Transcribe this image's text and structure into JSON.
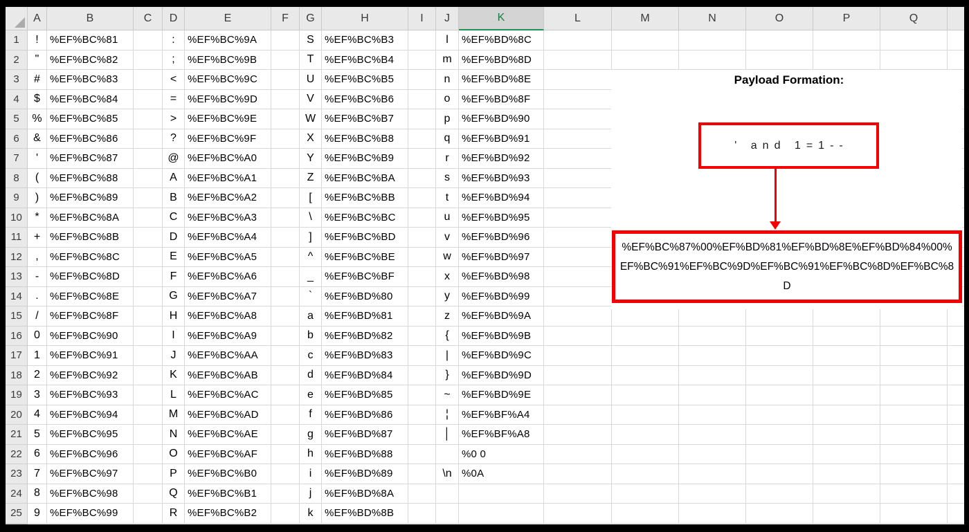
{
  "sheet": {
    "selected_column": "K",
    "columns": [
      "A",
      "B",
      "C",
      "D",
      "E",
      "F",
      "G",
      "H",
      "I",
      "J",
      "K",
      "L",
      "M",
      "N",
      "O",
      "P",
      "Q"
    ],
    "rows": [
      {
        "n": "1",
        "A": "!",
        "B": "%EF%BC%81",
        "D": ":",
        "E": "%EF%BC%9A",
        "G": "S",
        "H": "%EF%BC%B3",
        "J": "l",
        "K": "%EF%BD%8C"
      },
      {
        "n": "2",
        "A": "\"",
        "B": "%EF%BC%82",
        "D": ";",
        "E": "%EF%BC%9B",
        "G": "T",
        "H": "%EF%BC%B4",
        "J": "m",
        "K": "%EF%BD%8D"
      },
      {
        "n": "3",
        "A": "#",
        "B": "%EF%BC%83",
        "D": "<",
        "E": "%EF%BC%9C",
        "G": "U",
        "H": "%EF%BC%B5",
        "J": "n",
        "K": "%EF%BD%8E"
      },
      {
        "n": "4",
        "A": "$",
        "B": "%EF%BC%84",
        "D": "=",
        "E": "%EF%BC%9D",
        "G": "V",
        "H": "%EF%BC%B6",
        "J": "o",
        "K": "%EF%BD%8F"
      },
      {
        "n": "5",
        "A": "%",
        "B": "%EF%BC%85",
        "D": ">",
        "E": "%EF%BC%9E",
        "G": "W",
        "H": "%EF%BC%B7",
        "J": "p",
        "K": "%EF%BD%90"
      },
      {
        "n": "6",
        "A": "&",
        "B": "%EF%BC%86",
        "D": "?",
        "E": "%EF%BC%9F",
        "G": "X",
        "H": "%EF%BC%B8",
        "J": "q",
        "K": "%EF%BD%91"
      },
      {
        "n": "7",
        "A": "'",
        "B": "%EF%BC%87",
        "D": "@",
        "E": "%EF%BC%A0",
        "G": "Y",
        "H": "%EF%BC%B9",
        "J": "r",
        "K": "%EF%BD%92"
      },
      {
        "n": "8",
        "A": "(",
        "B": "%EF%BC%88",
        "D": "A",
        "E": "%EF%BC%A1",
        "G": "Z",
        "H": "%EF%BC%BA",
        "J": "s",
        "K": "%EF%BD%93"
      },
      {
        "n": "9",
        "A": ")",
        "B": "%EF%BC%89",
        "D": "B",
        "E": "%EF%BC%A2",
        "G": "[",
        "H": "%EF%BC%BB",
        "J": "t",
        "K": "%EF%BD%94"
      },
      {
        "n": "10",
        "A": "*",
        "B": "%EF%BC%8A",
        "D": "C",
        "E": "%EF%BC%A3",
        "G": "\\",
        "H": "%EF%BC%BC",
        "J": "u",
        "K": "%EF%BD%95"
      },
      {
        "n": "11",
        "A": "+",
        "B": "%EF%BC%8B",
        "D": "D",
        "E": "%EF%BC%A4",
        "G": "]",
        "H": "%EF%BC%BD",
        "J": "v",
        "K": "%EF%BD%96"
      },
      {
        "n": "12",
        "A": ",",
        "B": "%EF%BC%8C",
        "D": "E",
        "E": "%EF%BC%A5",
        "G": "^",
        "H": "%EF%BC%BE",
        "J": "w",
        "K": "%EF%BD%97"
      },
      {
        "n": "13",
        "A": "-",
        "B": "%EF%BC%8D",
        "D": "F",
        "E": "%EF%BC%A6",
        "G": "_",
        "H": "%EF%BC%BF",
        "J": "x",
        "K": "%EF%BD%98"
      },
      {
        "n": "14",
        "A": ".",
        "B": "%EF%BC%8E",
        "D": "G",
        "E": "%EF%BC%A7",
        "G": "`",
        "H": "%EF%BD%80",
        "J": "y",
        "K": "%EF%BD%99"
      },
      {
        "n": "15",
        "A": "/",
        "B": "%EF%BC%8F",
        "D": "H",
        "E": "%EF%BC%A8",
        "G": "a",
        "H": "%EF%BD%81",
        "J": "z",
        "K": "%EF%BD%9A"
      },
      {
        "n": "16",
        "A": "0",
        "B": "%EF%BC%90",
        "D": "I",
        "E": "%EF%BC%A9",
        "G": "b",
        "H": "%EF%BD%82",
        "J": "{",
        "K": "%EF%BD%9B"
      },
      {
        "n": "17",
        "A": "1",
        "B": "%EF%BC%91",
        "D": "J",
        "E": "%EF%BC%AA",
        "G": "c",
        "H": "%EF%BD%83",
        "J": "|",
        "K": "%EF%BD%9C"
      },
      {
        "n": "18",
        "A": "2",
        "B": "%EF%BC%92",
        "D": "K",
        "E": "%EF%BC%AB",
        "G": "d",
        "H": "%EF%BD%84",
        "J": "}",
        "K": "%EF%BD%9D"
      },
      {
        "n": "19",
        "A": "3",
        "B": "%EF%BC%93",
        "D": "L",
        "E": "%EF%BC%AC",
        "G": "e",
        "H": "%EF%BD%85",
        "J": "~",
        "K": "%EF%BD%9E"
      },
      {
        "n": "20",
        "A": "4",
        "B": "%EF%BC%94",
        "D": "M",
        "E": "%EF%BC%AD",
        "G": "f",
        "H": "%EF%BD%86",
        "J": "¦",
        "K": "%EF%BF%A4"
      },
      {
        "n": "21",
        "A": "5",
        "B": "%EF%BC%95",
        "D": "N",
        "E": "%EF%BC%AE",
        "G": "g",
        "H": "%EF%BD%87",
        "J": "│",
        "K": "%EF%BF%A8"
      },
      {
        "n": "22",
        "A": "6",
        "B": "%EF%BC%96",
        "D": "O",
        "E": "%EF%BC%AF",
        "G": "h",
        "H": "%EF%BD%88",
        "J": "",
        "K": "%0 0"
      },
      {
        "n": "23",
        "A": "7",
        "B": "%EF%BC%97",
        "D": "P",
        "E": "%EF%BC%B0",
        "G": "i",
        "H": "%EF%BD%89",
        "J": "\\n",
        "K": "%0A"
      },
      {
        "n": "24",
        "A": "8",
        "B": "%EF%BC%98",
        "D": "Q",
        "E": "%EF%BC%B1",
        "G": "j",
        "H": "%EF%BD%8A",
        "J": "",
        "K": ""
      },
      {
        "n": "25",
        "A": "9",
        "B": "%EF%BC%99",
        "D": "R",
        "E": "%EF%BC%B2",
        "G": "k",
        "H": "%EF%BD%8B",
        "J": "",
        "K": ""
      }
    ]
  },
  "annotation": {
    "title": "Payload Formation:",
    "box1_text": "' and 1=1--",
    "box2_text": "%EF%BC%87%00%EF%BD%81%EF%BD%8E%EF%BD%84%00%EF%BC%91%EF%BC%9D%EF%BC%91%EF%BC%8D%EF%BC%8D",
    "accent_red": "#f40000",
    "selected_header_green": "#1d7a46",
    "selected_underline_green": "#1f9254"
  }
}
